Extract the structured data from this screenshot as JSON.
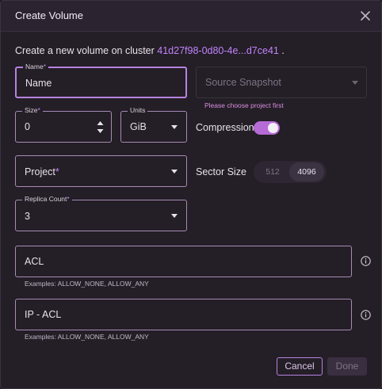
{
  "dialog": {
    "title": "Create Volume",
    "close_icon": "close-icon",
    "intro_text": "Create a new volume on cluster ",
    "cluster_id": "41d27f98-0d80-4e...d7ce41",
    "intro_suffix": "."
  },
  "form": {
    "name": {
      "label": "Name",
      "required_mark": "*",
      "value": "Name"
    },
    "source_snapshot": {
      "placeholder": "Source Snapshot",
      "helper": "Please choose project first"
    },
    "size": {
      "label": "Size",
      "required_mark": "*",
      "value": "0"
    },
    "units": {
      "label": "Units",
      "value": "GiB"
    },
    "compression": {
      "label": "Compression",
      "enabled": true
    },
    "project": {
      "placeholder": "Project",
      "required_mark": "*"
    },
    "sector_size": {
      "label": "Sector Size",
      "options": [
        "512",
        "4096"
      ],
      "selected": "4096"
    },
    "replica_count": {
      "label": "Replica Count",
      "required_mark": "*",
      "value": "3"
    },
    "acl": {
      "placeholder": "ACL",
      "helper": "Examples: ALLOW_NONE, ALLOW_ANY"
    },
    "ip_acl": {
      "placeholder": "IP - ACL",
      "helper": "Examples: ALLOW_NONE, ALLOW_ANY"
    }
  },
  "actions": {
    "cancel_label": "Cancel",
    "done_label": "Done"
  },
  "colors": {
    "accent": "#b66bd6",
    "link": "#c084fc",
    "background": "#241e26"
  }
}
